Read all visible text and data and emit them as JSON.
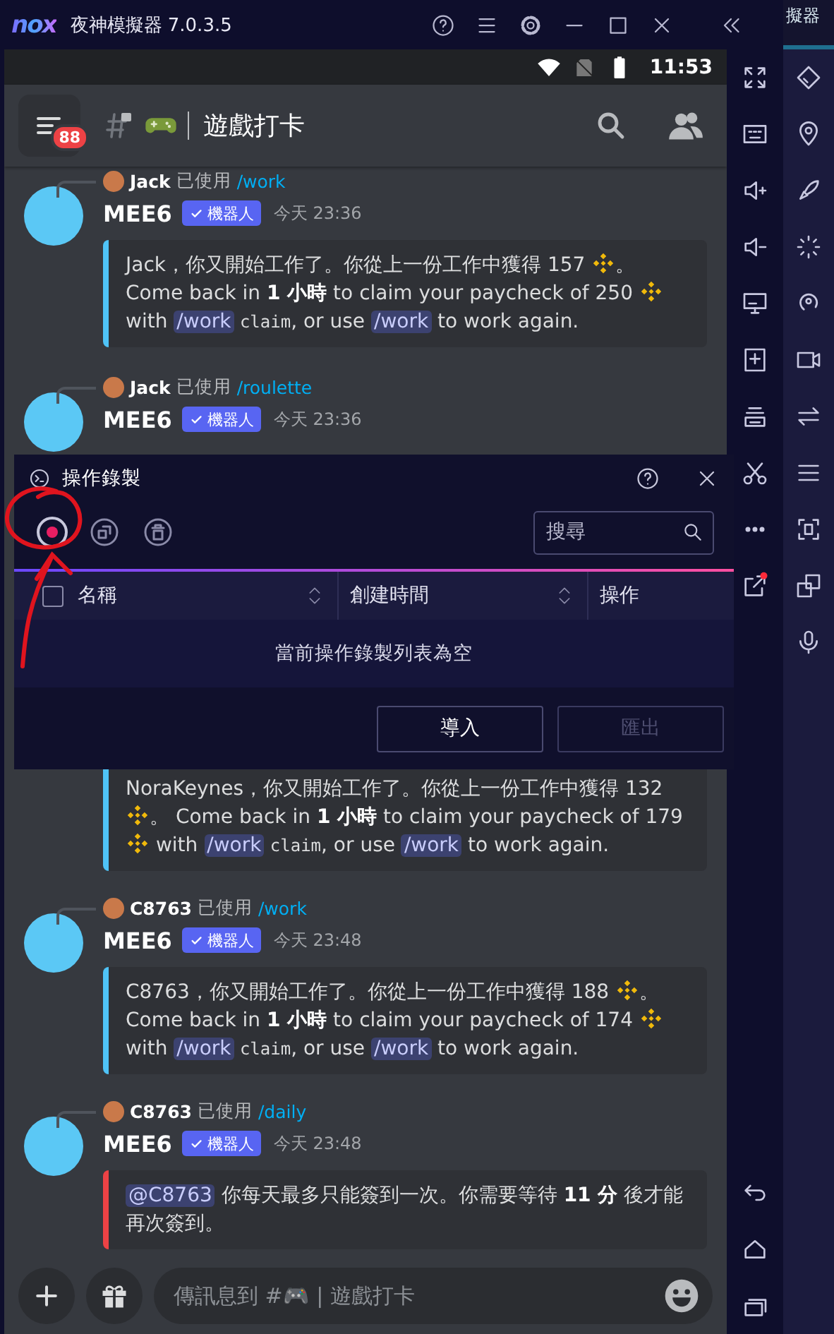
{
  "app": {
    "logo": "nox",
    "title": "夜神模擬器 7.0.3.5"
  },
  "background_window": {
    "title": "擬器"
  },
  "status_bar": {
    "time": "11:53"
  },
  "channel_header": {
    "badge": "88",
    "name": "遊戲打卡"
  },
  "messages": [
    {
      "reply": {
        "user": "Jack",
        "action": "已使用",
        "command": "/work"
      },
      "author": "MEE6",
      "badge": "機器人",
      "time": "今天 23:36",
      "embed": {
        "color": "#4fc3f7",
        "parts": [
          {
            "kind": "text",
            "text": "Jack，你又開始工作了。你從上一份工作中獲得 157 "
          },
          {
            "kind": "coin"
          },
          {
            "kind": "text",
            "text": "。 Come back in "
          },
          {
            "kind": "bold",
            "text": "1 小時"
          },
          {
            "kind": "text",
            "text": " to claim your paycheck of 250 "
          },
          {
            "kind": "coin"
          },
          {
            "kind": "text",
            "text": " with "
          },
          {
            "kind": "command",
            "text": "/work"
          },
          {
            "kind": "code",
            "text": "claim"
          },
          {
            "kind": "text",
            "text": ", or use "
          },
          {
            "kind": "command",
            "text": "/work"
          },
          {
            "kind": "text",
            "text": " to work again."
          }
        ]
      }
    },
    {
      "reply": {
        "user": "Jack",
        "action": "已使用",
        "command": "/roulette"
      },
      "author": "MEE6",
      "badge": "機器人",
      "time": "今天 23:36"
    },
    {
      "embed": {
        "color": "#4fc3f7",
        "parts": [
          {
            "kind": "text",
            "text": "NoraKeynes，你又開始工作了。你從上一份工作中獲得 132 "
          },
          {
            "kind": "coin"
          },
          {
            "kind": "text",
            "text": "。 Come back in "
          },
          {
            "kind": "bold",
            "text": "1 小時"
          },
          {
            "kind": "text",
            "text": " to claim your paycheck of 179 "
          },
          {
            "kind": "coin"
          },
          {
            "kind": "text",
            "text": " with "
          },
          {
            "kind": "command",
            "text": "/work"
          },
          {
            "kind": "code",
            "text": "claim"
          },
          {
            "kind": "text",
            "text": ", or use "
          },
          {
            "kind": "command",
            "text": "/work"
          },
          {
            "kind": "text",
            "text": " to work again."
          }
        ]
      }
    },
    {
      "reply": {
        "user": "C8763",
        "action": "已使用",
        "command": "/work"
      },
      "author": "MEE6",
      "badge": "機器人",
      "time": "今天 23:48",
      "embed": {
        "color": "#4fc3f7",
        "parts": [
          {
            "kind": "text",
            "text": "C8763，你又開始工作了。你從上一份工作中獲得 188 "
          },
          {
            "kind": "coin"
          },
          {
            "kind": "text",
            "text": "。 Come back in "
          },
          {
            "kind": "bold",
            "text": "1 小時"
          },
          {
            "kind": "text",
            "text": " to claim your paycheck of 174 "
          },
          {
            "kind": "coin"
          },
          {
            "kind": "text",
            "text": " with "
          },
          {
            "kind": "command",
            "text": "/work"
          },
          {
            "kind": "code",
            "text": "claim"
          },
          {
            "kind": "text",
            "text": ", or use "
          },
          {
            "kind": "command",
            "text": "/work"
          },
          {
            "kind": "text",
            "text": " to work again."
          }
        ]
      }
    },
    {
      "reply": {
        "user": "C8763",
        "action": "已使用",
        "command": "/daily"
      },
      "author": "MEE6",
      "badge": "機器人",
      "time": "今天 23:48",
      "embed": {
        "color": "#ed4245",
        "parts": [
          {
            "kind": "mention",
            "text": "@C8763"
          },
          {
            "kind": "text",
            "text": " 你每天最多只能簽到一次。你需要等待 "
          },
          {
            "kind": "bold",
            "text": "11 分"
          },
          {
            "kind": "text",
            "text": " 後才能再次簽到。"
          }
        ]
      }
    }
  ],
  "message_input": {
    "placeholder": "傳訊息到 #🎮 | 遊戲打卡"
  },
  "dialog": {
    "title": "操作錄製",
    "search": {
      "placeholder": "搜尋"
    },
    "select_all": {
      "checked": false
    },
    "columns": [
      {
        "label": "名稱",
        "sortable": true
      },
      {
        "label": "創建時間",
        "sortable": true
      },
      {
        "label": "操作",
        "sortable": false
      }
    ],
    "empty_text": "當前操作錄製列表為空",
    "buttons": [
      {
        "label": "導入",
        "disabled": false
      },
      {
        "label": "匯出",
        "disabled": true
      }
    ]
  }
}
